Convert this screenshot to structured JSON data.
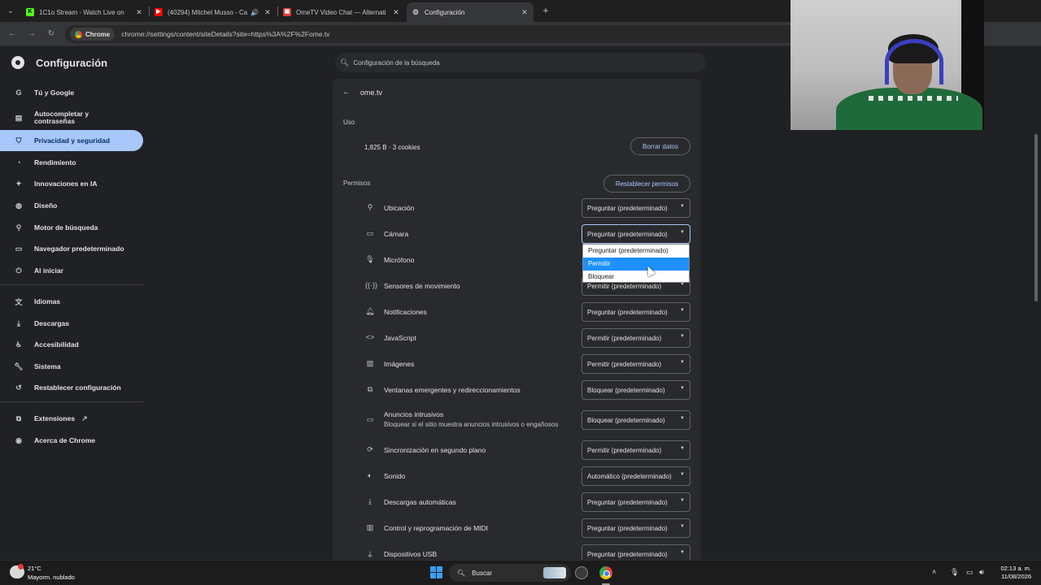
{
  "tabs": [
    {
      "title": "1C1o Stream - Watch Live on",
      "favicon": "kick-icon",
      "color": "#53fc18"
    },
    {
      "title": "(40294) Mitchel Musso - Ca",
      "favicon": "youtube-icon",
      "color": "#ff0000"
    },
    {
      "title": "OmeTV Video Chat — Alternati",
      "favicon": "ometv-icon",
      "color": "#e53935"
    },
    {
      "title": "Configuración",
      "favicon": "gear-icon",
      "color": "#c4c7c5"
    }
  ],
  "omnibox": {
    "chip": "Chrome",
    "url": "chrome://settings/content/siteDetails?site=https%3A%2F%2Fome.tv"
  },
  "header": {
    "title": "Configuración",
    "search_placeholder": "Configuración de la búsqueda"
  },
  "sidebar": {
    "items": [
      {
        "label": "Tú y Google",
        "icon": "google-icon"
      },
      {
        "label": "Autocompletar y contraseñas",
        "icon": "autofill-icon"
      },
      {
        "label": "Privacidad y seguridad",
        "icon": "shield-icon",
        "selected": true
      },
      {
        "label": "Rendimiento",
        "icon": "speedometer-icon"
      },
      {
        "label": "Innovaciones en IA",
        "icon": "sparkle-icon"
      },
      {
        "label": "Diseño",
        "icon": "palette-icon"
      },
      {
        "label": "Motor de búsqueda",
        "icon": "search-icon"
      },
      {
        "label": "Navegador predeterminado",
        "icon": "browser-icon"
      },
      {
        "label": "Al iniciar",
        "icon": "power-icon"
      },
      {
        "label": "Idiomas",
        "icon": "translate-icon"
      },
      {
        "label": "Descargas",
        "icon": "download-icon"
      },
      {
        "label": "Accesibilidad",
        "icon": "accessibility-icon"
      },
      {
        "label": "Sistema",
        "icon": "wrench-icon"
      },
      {
        "label": "Restablecer configuración",
        "icon": "reset-icon"
      },
      {
        "label": "Extensiones",
        "icon": "puzzle-icon"
      },
      {
        "label": "Acerca de Chrome",
        "icon": "chrome-icon"
      }
    ]
  },
  "site": {
    "name": "ome.tv",
    "usage_label": "Uso",
    "usage_value": "1,825 B · 3 cookies",
    "clear_button": "Borrar datos",
    "permissions_label": "Permisos",
    "reset_button": "Restablecer permisos"
  },
  "permissions": [
    {
      "label": "Ubicación",
      "value": "Preguntar (predeterminado)",
      "icon": "location-icon"
    },
    {
      "label": "Cámara",
      "value": "Preguntar (predeterminado)",
      "icon": "camera-icon"
    },
    {
      "label": "Micrófono",
      "value": "Preguntar (predeterminado)",
      "icon": "microphone-icon"
    },
    {
      "label": "Sensores de movimiento",
      "value": "Permitir (predeterminado)",
      "icon": "sensors-icon"
    },
    {
      "label": "Notificaciones",
      "value": "Preguntar (predeterminado)",
      "icon": "bell-icon"
    },
    {
      "label": "JavaScript",
      "value": "Permitir (predeterminado)",
      "icon": "code-icon"
    },
    {
      "label": "Imágenes",
      "value": "Permitir (predeterminado)",
      "icon": "image-icon"
    },
    {
      "label": "Ventanas emergentes y redireccionamientos",
      "value": "Bloquear (predeterminado)",
      "icon": "popup-icon"
    },
    {
      "label": "Anuncios intrusivos",
      "sublabel": "Bloquear si el sitio muestra anuncios intrusivos o engañosos",
      "value": "Bloquear (predeterminado)",
      "icon": "ads-icon"
    },
    {
      "label": "Sincronización en segundo plano",
      "value": "Permitir (predeterminado)",
      "icon": "sync-icon"
    },
    {
      "label": "Sonido",
      "value": "Automático (predeterminado)",
      "icon": "speaker-icon"
    },
    {
      "label": "Descargas automáticas",
      "value": "Preguntar (predeterminado)",
      "icon": "download-icon"
    },
    {
      "label": "Control y reprogramación de MIDI",
      "value": "Preguntar (predeterminado)",
      "icon": "midi-icon"
    },
    {
      "label": "Dispositivos USB",
      "value": "Preguntar (predeterminado)",
      "icon": "usb-icon"
    }
  ],
  "dropdown": {
    "options": [
      "Preguntar (predeterminado)",
      "Permitir",
      "Bloquear"
    ],
    "highlighted": "Permitir"
  },
  "taskbar": {
    "temperature": "21°C",
    "weather": "Mayorm. nublado",
    "search": "Buscar",
    "time": "02:13 a. m.",
    "date": "11/08/2026"
  }
}
